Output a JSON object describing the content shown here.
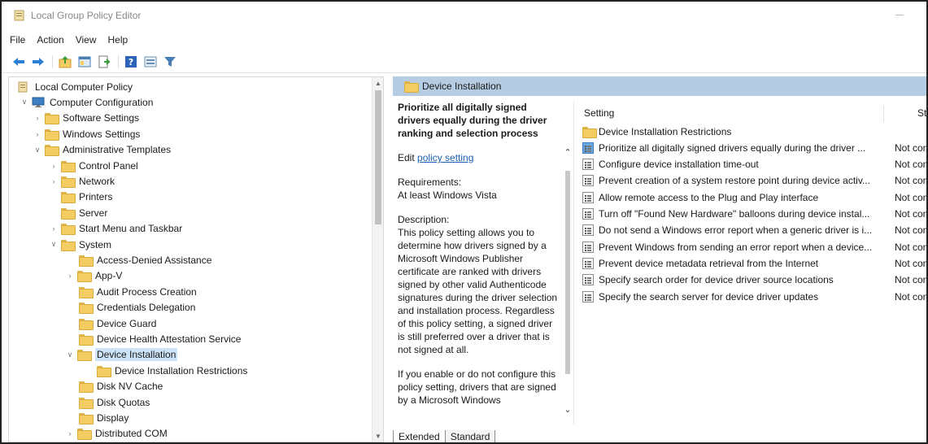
{
  "window": {
    "title": "Local Group Policy Editor"
  },
  "menu": [
    "File",
    "Action",
    "View",
    "Help"
  ],
  "toolbar": [
    "back-arrow-icon",
    "forward-arrow-icon",
    "up-folder-icon",
    "show-hide-tree-icon",
    "export-list-icon",
    "help-icon",
    "view-icon",
    "filter-icon"
  ],
  "tree": {
    "items": [
      {
        "label": "Local Computer Policy",
        "depth": 0,
        "chevron": "",
        "icon": "policy"
      },
      {
        "label": "Computer Configuration",
        "depth": 1,
        "chevron": "v",
        "icon": "computer"
      },
      {
        "label": "Software Settings",
        "depth": 2,
        "chevron": ">",
        "icon": "folder"
      },
      {
        "label": "Windows Settings",
        "depth": 2,
        "chevron": ">",
        "icon": "folder"
      },
      {
        "label": "Administrative Templates",
        "depth": 2,
        "chevron": "v",
        "icon": "folder"
      },
      {
        "label": "Control Panel",
        "depth": 3,
        "chevron": ">",
        "icon": "folder"
      },
      {
        "label": "Network",
        "depth": 3,
        "chevron": ">",
        "icon": "folder"
      },
      {
        "label": "Printers",
        "depth": 3,
        "chevron": "",
        "icon": "folder"
      },
      {
        "label": "Server",
        "depth": 3,
        "chevron": "",
        "icon": "folder"
      },
      {
        "label": "Start Menu and Taskbar",
        "depth": 3,
        "chevron": ">",
        "icon": "folder"
      },
      {
        "label": "System",
        "depth": 3,
        "chevron": "v",
        "icon": "folder"
      },
      {
        "label": "Access-Denied Assistance",
        "depth": 4,
        "chevron": "",
        "icon": "folder"
      },
      {
        "label": "App-V",
        "depth": 4,
        "chevron": ">",
        "icon": "folder"
      },
      {
        "label": "Audit Process Creation",
        "depth": 4,
        "chevron": "",
        "icon": "folder"
      },
      {
        "label": "Credentials Delegation",
        "depth": 4,
        "chevron": "",
        "icon": "folder"
      },
      {
        "label": "Device Guard",
        "depth": 4,
        "chevron": "",
        "icon": "folder"
      },
      {
        "label": "Device Health Attestation Service",
        "depth": 4,
        "chevron": "",
        "icon": "folder"
      },
      {
        "label": "Device Installation",
        "depth": 4,
        "chevron": "v",
        "icon": "folder",
        "selected": true
      },
      {
        "label": "Device Installation Restrictions",
        "depth": 5,
        "chevron": "",
        "icon": "folder"
      },
      {
        "label": "Disk NV Cache",
        "depth": 4,
        "chevron": "",
        "icon": "folder"
      },
      {
        "label": "Disk Quotas",
        "depth": 4,
        "chevron": "",
        "icon": "folder"
      },
      {
        "label": "Display",
        "depth": 4,
        "chevron": "",
        "icon": "folder"
      },
      {
        "label": "Distributed COM",
        "depth": 4,
        "chevron": ">",
        "icon": "folder"
      }
    ]
  },
  "details": {
    "header": "Device Installation",
    "policy_title": "Prioritize all digitally signed drivers equally during the driver ranking and selection process",
    "edit_prefix": "Edit ",
    "edit_link": "policy setting",
    "requirements_label": "Requirements:",
    "requirements_value": "At least Windows Vista",
    "description_label": "Description:",
    "description_text": "This policy setting allows you to determine how drivers signed by a Microsoft Windows Publisher certificate are ranked with drivers signed by other valid Authenticode signatures during the driver selection and installation process. Regardless of this policy setting, a signed driver is still preferred over a driver that is not signed at all.",
    "description_more": "If you enable or do not configure this policy setting, drivers that are signed by a Microsoft Windows"
  },
  "list": {
    "col_setting": "Setting",
    "col_state": "St",
    "rows": [
      {
        "name": "Device Installation Restrictions",
        "state": "",
        "type": "folder"
      },
      {
        "name": "Prioritize all digitally signed drivers equally during the driver ...",
        "state": "Not con",
        "type": "policy",
        "active": true
      },
      {
        "name": "Configure device installation time-out",
        "state": "Not con",
        "type": "policy"
      },
      {
        "name": "Prevent creation of a system restore point during device activ...",
        "state": "Not con",
        "type": "policy"
      },
      {
        "name": "Allow remote access to the Plug and Play interface",
        "state": "Not con",
        "type": "policy"
      },
      {
        "name": "Turn off \"Found New Hardware\" balloons during device instal...",
        "state": "Not con",
        "type": "policy"
      },
      {
        "name": "Do not send a Windows error report when a generic driver is i...",
        "state": "Not con",
        "type": "policy"
      },
      {
        "name": "Prevent Windows from sending an error report when a device...",
        "state": "Not con",
        "type": "policy"
      },
      {
        "name": "Prevent device metadata retrieval from the Internet",
        "state": "Not con",
        "type": "policy"
      },
      {
        "name": "Specify search order for device driver source locations",
        "state": "Not con",
        "type": "policy"
      },
      {
        "name": "Specify the search server for device driver updates",
        "state": "Not con",
        "type": "policy"
      }
    ]
  },
  "tabs": [
    "Extended",
    "Standard"
  ]
}
